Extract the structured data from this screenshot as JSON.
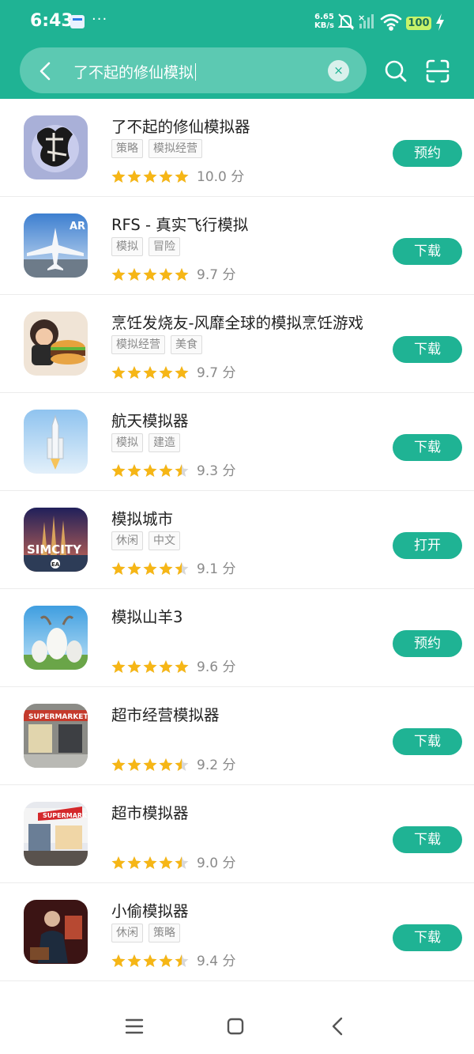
{
  "status_bar": {
    "time": "6:43",
    "dots": "···",
    "net_speed_value": "6.65",
    "net_speed_unit": "KB/s",
    "battery": "100"
  },
  "search": {
    "query": "了不起的修仙模拟",
    "clear_symbol": "×"
  },
  "apps": [
    {
      "name": "了不起的修仙模拟器",
      "tags": [
        "策略",
        "模拟经营"
      ],
      "rating": 5.0,
      "score": "10.0 分",
      "action": "预约"
    },
    {
      "name": "RFS - 真实飞行模拟",
      "tags": [
        "模拟",
        "冒险"
      ],
      "rating": 5.0,
      "score": "9.7 分",
      "action": "下载"
    },
    {
      "name": "烹饪发烧友-风靡全球的模拟烹饪游戏",
      "tags": [
        "模拟经营",
        "美食"
      ],
      "rating": 5.0,
      "score": "9.7 分",
      "action": "下载"
    },
    {
      "name": "航天模拟器",
      "tags": [
        "模拟",
        "建造"
      ],
      "rating": 4.5,
      "score": "9.3 分",
      "action": "下载"
    },
    {
      "name": "模拟城市",
      "tags": [
        "休闲",
        "中文"
      ],
      "rating": 4.5,
      "score": "9.1 分",
      "action": "打开"
    },
    {
      "name": "模拟山羊3",
      "tags": [],
      "rating": 5.0,
      "score": "9.6 分",
      "action": "预约"
    },
    {
      "name": "超市经营模拟器",
      "tags": [],
      "rating": 4.5,
      "score": "9.2 分",
      "action": "下载"
    },
    {
      "name": "超市模拟器",
      "tags": [],
      "rating": 4.5,
      "score": "9.0 分",
      "action": "下载"
    },
    {
      "name": "小偷模拟器",
      "tags": [
        "休闲",
        "策略"
      ],
      "rating": 4.5,
      "score": "9.4 分",
      "action": "下载"
    }
  ],
  "icon_labels": {
    "simcity": "SIMCITY",
    "supermarket": "SUPERMARKET",
    "ar": "AR",
    "ea": "EA"
  },
  "colors": {
    "accent": "#1fb394",
    "star": "#f6b616",
    "star_empty": "#d8d8d8"
  }
}
